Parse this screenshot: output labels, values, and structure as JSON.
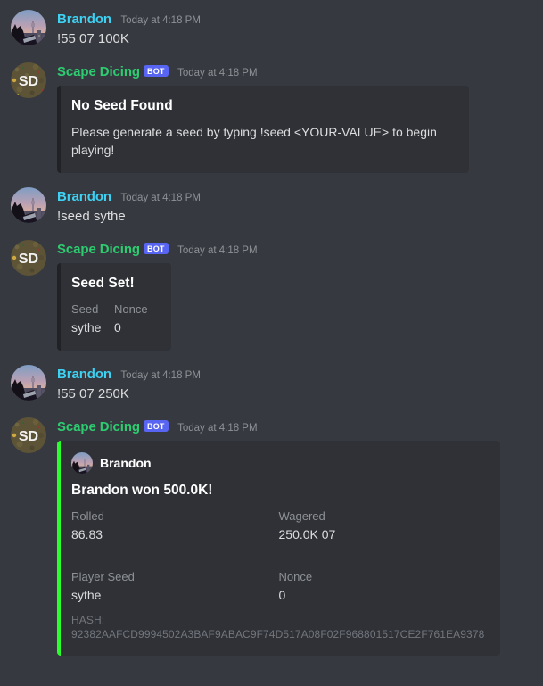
{
  "theme": {
    "app_background": "#36393f",
    "embed_background": "#2f3136",
    "user_name_color": "#3dd2f3",
    "bot_name_color": "#2ecc71",
    "bot_badge_color": "#5865f2",
    "win_embed_accent": "#2bff2b",
    "muted_text_color": "#8e9297"
  },
  "users": {
    "brandon": {
      "name": "Brandon",
      "avatar_icon": "cat-skyline-avatar"
    },
    "bot": {
      "name": "Scape Dicing",
      "badge": "BOT",
      "avatar_icon": "sd-bot-avatar",
      "avatar_initials": "SD"
    }
  },
  "messages": [
    {
      "id": "msg-1",
      "author": "Brandon",
      "author_type": "user",
      "timestamp": "Today at 4:18 PM",
      "text": "!55 07 100K"
    },
    {
      "id": "msg-2",
      "author": "Scape Dicing",
      "author_type": "bot",
      "badge": "BOT",
      "timestamp": "Today at 4:18 PM",
      "embed": {
        "title": "No Seed Found",
        "description": "Please generate a seed by typing !seed <YOUR-VALUE> to begin playing!"
      }
    },
    {
      "id": "msg-3",
      "author": "Brandon",
      "author_type": "user",
      "timestamp": "Today at 4:18 PM",
      "text": "!seed sythe"
    },
    {
      "id": "msg-4",
      "author": "Scape Dicing",
      "author_type": "bot",
      "badge": "BOT",
      "timestamp": "Today at 4:18 PM",
      "embed": {
        "title": "Seed Set!",
        "fields": [
          {
            "name": "Seed",
            "value": "sythe"
          },
          {
            "name": "Nonce",
            "value": "0"
          }
        ]
      }
    },
    {
      "id": "msg-5",
      "author": "Brandon",
      "author_type": "user",
      "timestamp": "Today at 4:18 PM",
      "text": "!55 07 250K"
    },
    {
      "id": "msg-6",
      "author": "Scape Dicing",
      "author_type": "bot",
      "badge": "BOT",
      "timestamp": "Today at 4:18 PM",
      "embed": {
        "accent_color": "#2bff2b",
        "author_name": "Brandon",
        "title": "Brandon won 500.0K!",
        "fields_row_1": [
          {
            "name": "Rolled",
            "value": "86.83"
          },
          {
            "name": "Wagered",
            "value": "250.0K 07"
          }
        ],
        "fields_row_2": [
          {
            "name": "Player Seed",
            "value": "sythe"
          },
          {
            "name": "Nonce",
            "value": "0"
          }
        ],
        "footer": "HASH: 92382AAFCD9994502A3BAF9ABAC9F74D517A08F02F968801517CE2F761EA9378"
      }
    }
  ]
}
